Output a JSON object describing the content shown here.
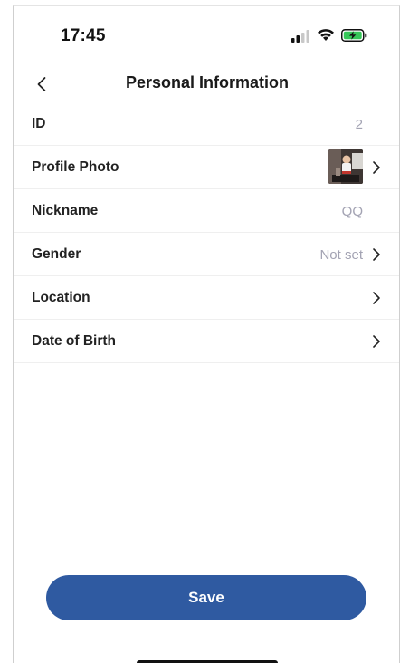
{
  "status_bar": {
    "time": "17:45",
    "icons": [
      "signal-icon",
      "wifi-icon",
      "battery-charging-icon"
    ],
    "battery_color": "#36c759"
  },
  "nav": {
    "title": "Personal Information",
    "back_icon": "chevron-left-icon"
  },
  "rows": [
    {
      "label": "ID",
      "value": "2"
    },
    {
      "label": "Profile Photo",
      "value": ""
    },
    {
      "label": "Nickname",
      "value": "QQ"
    },
    {
      "label": "Gender",
      "value": "Not set"
    },
    {
      "label": "Location",
      "value": ""
    },
    {
      "label": "Date of Birth",
      "value": ""
    }
  ],
  "save": {
    "label": "Save"
  },
  "colors": {
    "accent": "#2f5aa1",
    "value_text": "#a3a3b3"
  }
}
